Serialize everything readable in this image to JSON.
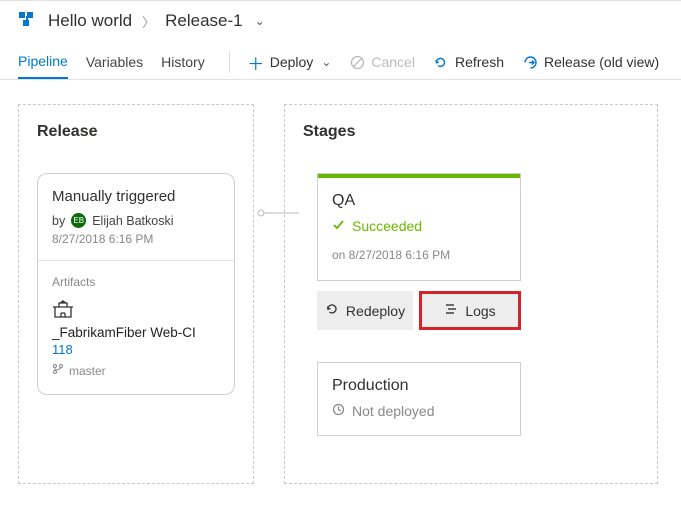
{
  "breadcrumb": {
    "project": "Hello world",
    "release": "Release-1"
  },
  "tabs": {
    "pipeline": "Pipeline",
    "variables": "Variables",
    "history": "History"
  },
  "toolbar": {
    "deploy": "Deploy",
    "cancel": "Cancel",
    "refresh": "Refresh",
    "old_view": "Release (old view)"
  },
  "release_panel": {
    "title": "Release",
    "trigger": "Manually triggered",
    "by_prefix": "by",
    "user": "Elijah Batkoski",
    "timestamp": "8/27/2018 6:16 PM",
    "artifacts_label": "Artifacts",
    "artifact": {
      "name": "_FabrikamFiber Web-CI",
      "build_id": "118",
      "branch": "master"
    }
  },
  "stages_panel": {
    "title": "Stages",
    "qa": {
      "name": "QA",
      "status": "Succeeded",
      "timestamp": "on 8/27/2018 6:16 PM",
      "redeploy": "Redeploy",
      "logs": "Logs"
    },
    "production": {
      "name": "Production",
      "status": "Not deployed"
    }
  }
}
